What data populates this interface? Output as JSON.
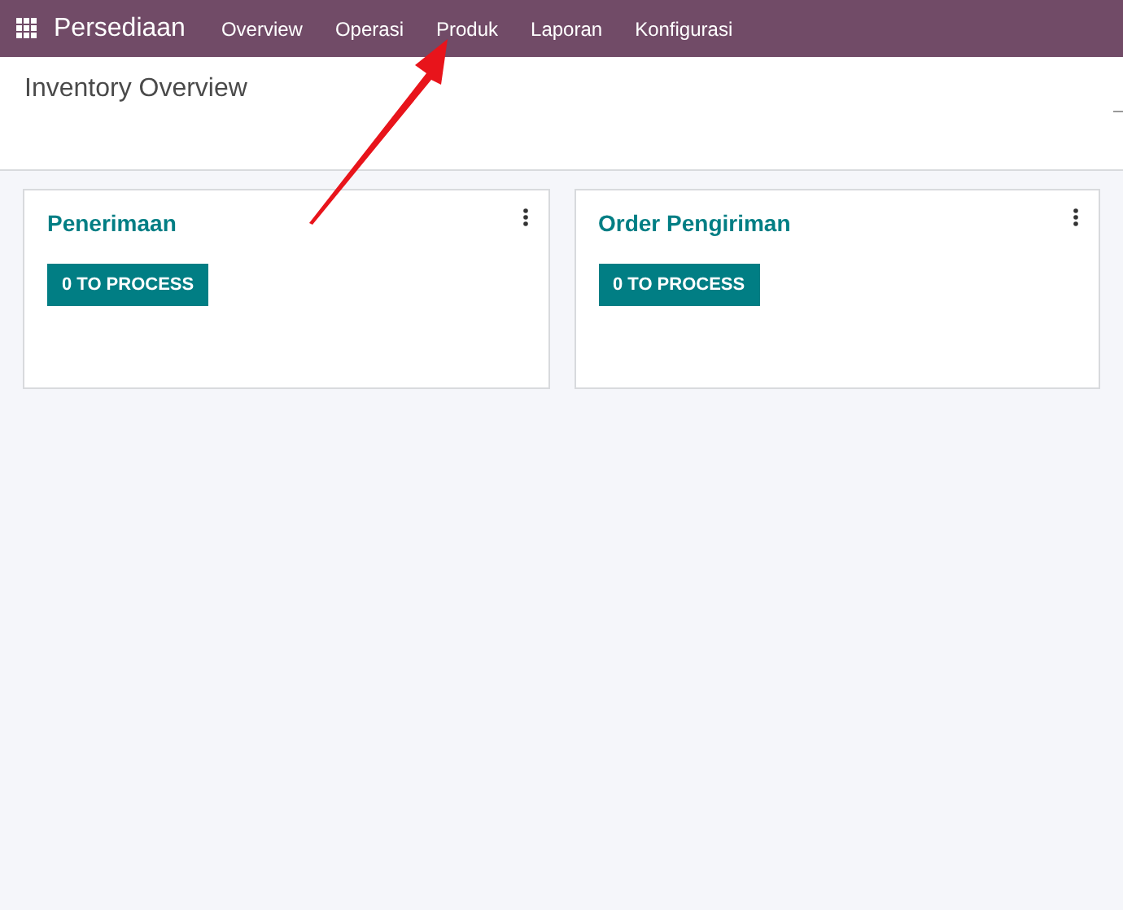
{
  "navbar": {
    "app_name": "Persediaan",
    "menu": [
      "Overview",
      "Operasi",
      "Produk",
      "Laporan",
      "Konfigurasi"
    ]
  },
  "page_title": "Inventory Overview",
  "cards": [
    {
      "title": "Penerimaan",
      "button": "0 TO PROCESS"
    },
    {
      "title": "Order Pengiriman",
      "button": "0 TO PROCESS"
    }
  ]
}
